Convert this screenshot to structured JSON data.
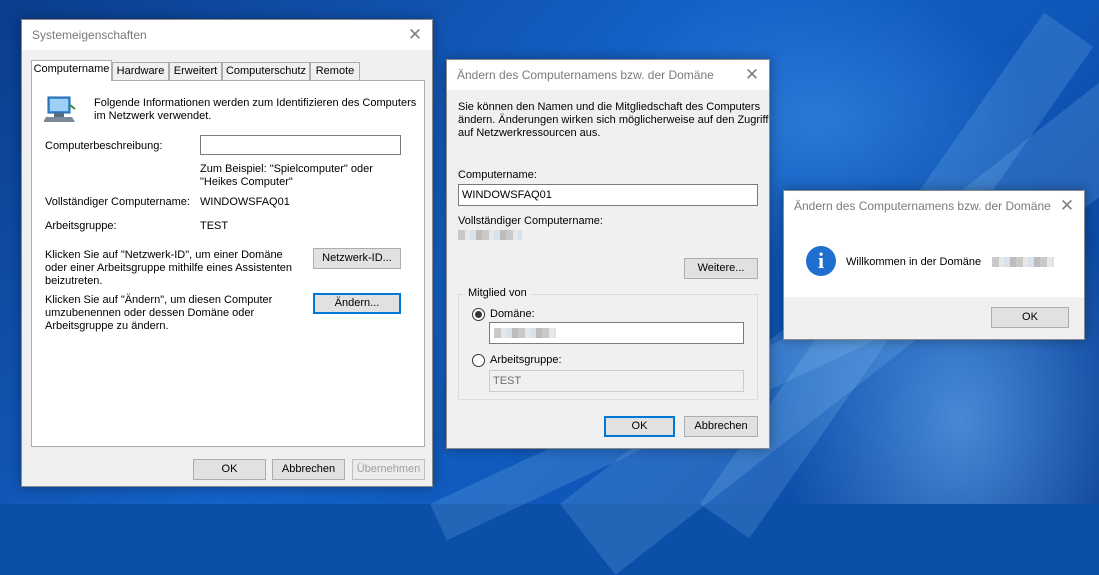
{
  "system_properties": {
    "title": "Systemeigenschaften",
    "close_symbol": "✕",
    "tabs": [
      "Computername",
      "Hardware",
      "Erweitert",
      "Computerschutz",
      "Remote"
    ],
    "intro_line1": "Folgende Informationen werden zum Identifizieren des Computers",
    "intro_line2": "im Netzwerk verwendet.",
    "description_label": "Computerbeschreibung:",
    "description_value": "",
    "example_line1": "Zum Beispiel: \"Spielcomputer\" oder",
    "example_line2": "\"Heikes Computer\"",
    "full_name_label": "Vollständiger Computername:",
    "full_name_value": "WINDOWSFAQ01",
    "workgroup_label": "Arbeitsgruppe:",
    "workgroup_value": "TEST",
    "network_id_text_line1": "Klicken Sie auf \"Netzwerk-ID\", um einer Domäne",
    "network_id_text_line2": "oder einer Arbeitsgruppe mithilfe eines Assistenten",
    "network_id_text_line3": "beizutreten.",
    "network_id_button": "Netzwerk-ID...",
    "change_text_line1": "Klicken Sie auf \"Ändern\", um diesen Computer",
    "change_text_line2": "umzubenennen oder dessen Domäne oder",
    "change_text_line3": "Arbeitsgruppe zu ändern.",
    "change_button": "Ändern...",
    "ok_button": "OK",
    "cancel_button": "Abbrechen",
    "apply_button": "Übernehmen"
  },
  "change_dialog": {
    "title": "Ändern des Computernamens bzw. der Domäne",
    "close_symbol": "✕",
    "intro_line1": "Sie können den Namen und die Mitgliedschaft des Computers",
    "intro_line2": "ändern. Änderungen wirken sich möglicherweise auf den Zugriff",
    "intro_line3": "auf Netzwerkressourcen aus.",
    "computer_name_label": "Computername:",
    "computer_name_value": "WINDOWSFAQ01",
    "full_name_label": "Vollständiger Computername:",
    "more_button": "Weitere...",
    "member_of_label": "Mitglied von",
    "domain_label": "Domäne:",
    "workgroup_label": "Arbeitsgruppe:",
    "workgroup_value": "TEST",
    "ok_button": "OK",
    "cancel_button": "Abbrechen"
  },
  "welcome_dialog": {
    "title": "Ändern des Computernamens bzw. der Domäne",
    "close_symbol": "✕",
    "icon": "info-icon",
    "icon_glyph": "i",
    "message": "Willkommen in der Domäne",
    "ok_button": "OK"
  }
}
